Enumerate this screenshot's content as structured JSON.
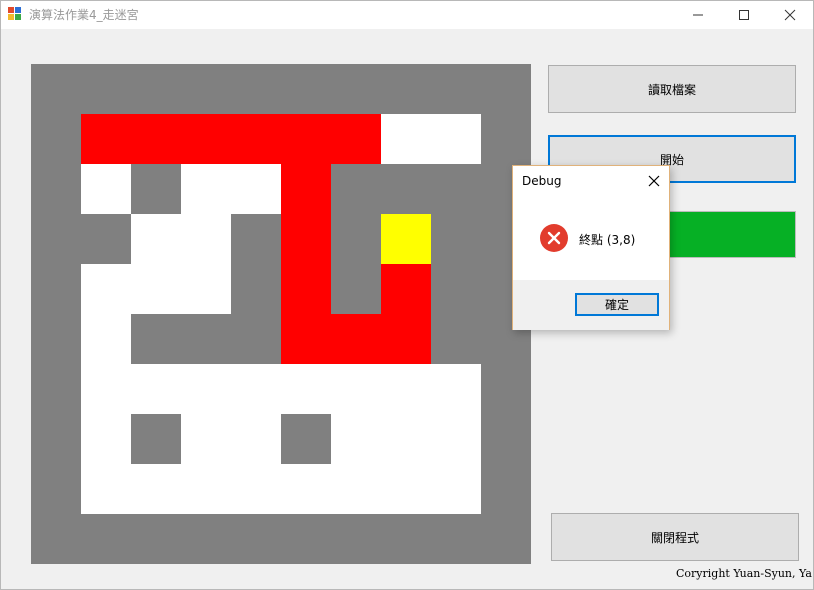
{
  "window": {
    "title": "演算法作業4_走迷宮",
    "controls": {
      "minimize_icon": "minimize-icon",
      "maximize_icon": "maximize-icon",
      "close_icon": "close-icon"
    }
  },
  "maze": {
    "colors": {
      "wall": "#808080",
      "open": "#ffffff",
      "path": "#ff0000",
      "end": "#ffff00"
    },
    "grid": [
      "WWWWWWWWWW",
      "WPPPPPPOOW",
      "WOWOOPWWWW",
      "WWOOWPWEWW",
      "WOOOWPWPWW",
      "WOWWWPPPWW",
      "WOOOOOOOOW",
      "WOWOOWOOOW",
      "WOOOOOOOOW",
      "WWWWWWWWWW"
    ]
  },
  "buttons": {
    "read_file": "讀取檔案",
    "start": "開始",
    "close_program": "關閉程式"
  },
  "progress": {
    "value_percent": 100,
    "color": "#06b025"
  },
  "copyright": "Coryright Yuan-Syun, Ya",
  "dialog": {
    "title": "Debug",
    "icon": "error-icon",
    "message": "終點 (3,8)",
    "ok_label": "確定",
    "close_icon": "close-icon"
  }
}
